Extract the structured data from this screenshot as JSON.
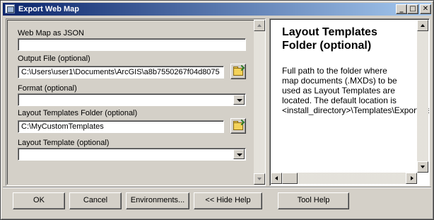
{
  "window": {
    "title": "Export Web Map",
    "minimize": "_",
    "maximize": "□",
    "close": "✕"
  },
  "params": {
    "web_map_json": {
      "label": "Web Map as JSON",
      "value": ""
    },
    "output_file": {
      "label": "Output File (optional)",
      "value": "C:\\Users\\user1\\Documents\\ArcGIS\\a8b7550267f04d8075"
    },
    "format": {
      "label": "Format (optional)",
      "value": ""
    },
    "layout_templates_folder": {
      "label": "Layout Templates Folder (optional)",
      "value": "C:\\MyCustomTemplates"
    },
    "layout_template": {
      "label": "Layout Template (optional)",
      "value": ""
    }
  },
  "help": {
    "title": "Layout Templates Folder (optional)",
    "body_lines": [
      "Full path to the folder where",
      "map documents (.MXDs) to be",
      "used as Layout Templates are",
      "located. The default location is",
      "<install_directory>\\Templates\\ExportWebMapTemplates"
    ]
  },
  "buttons": {
    "ok": "OK",
    "cancel": "Cancel",
    "environments": "Environments...",
    "hide_help": "<< Hide Help",
    "tool_help": "Tool Help"
  },
  "icons": {
    "title": "toolbox-icon",
    "folder": "open-folder-icon"
  },
  "colors": {
    "titlebar_start": "#0a246a",
    "titlebar_end": "#a6caf0",
    "face": "#d4d0c8"
  }
}
